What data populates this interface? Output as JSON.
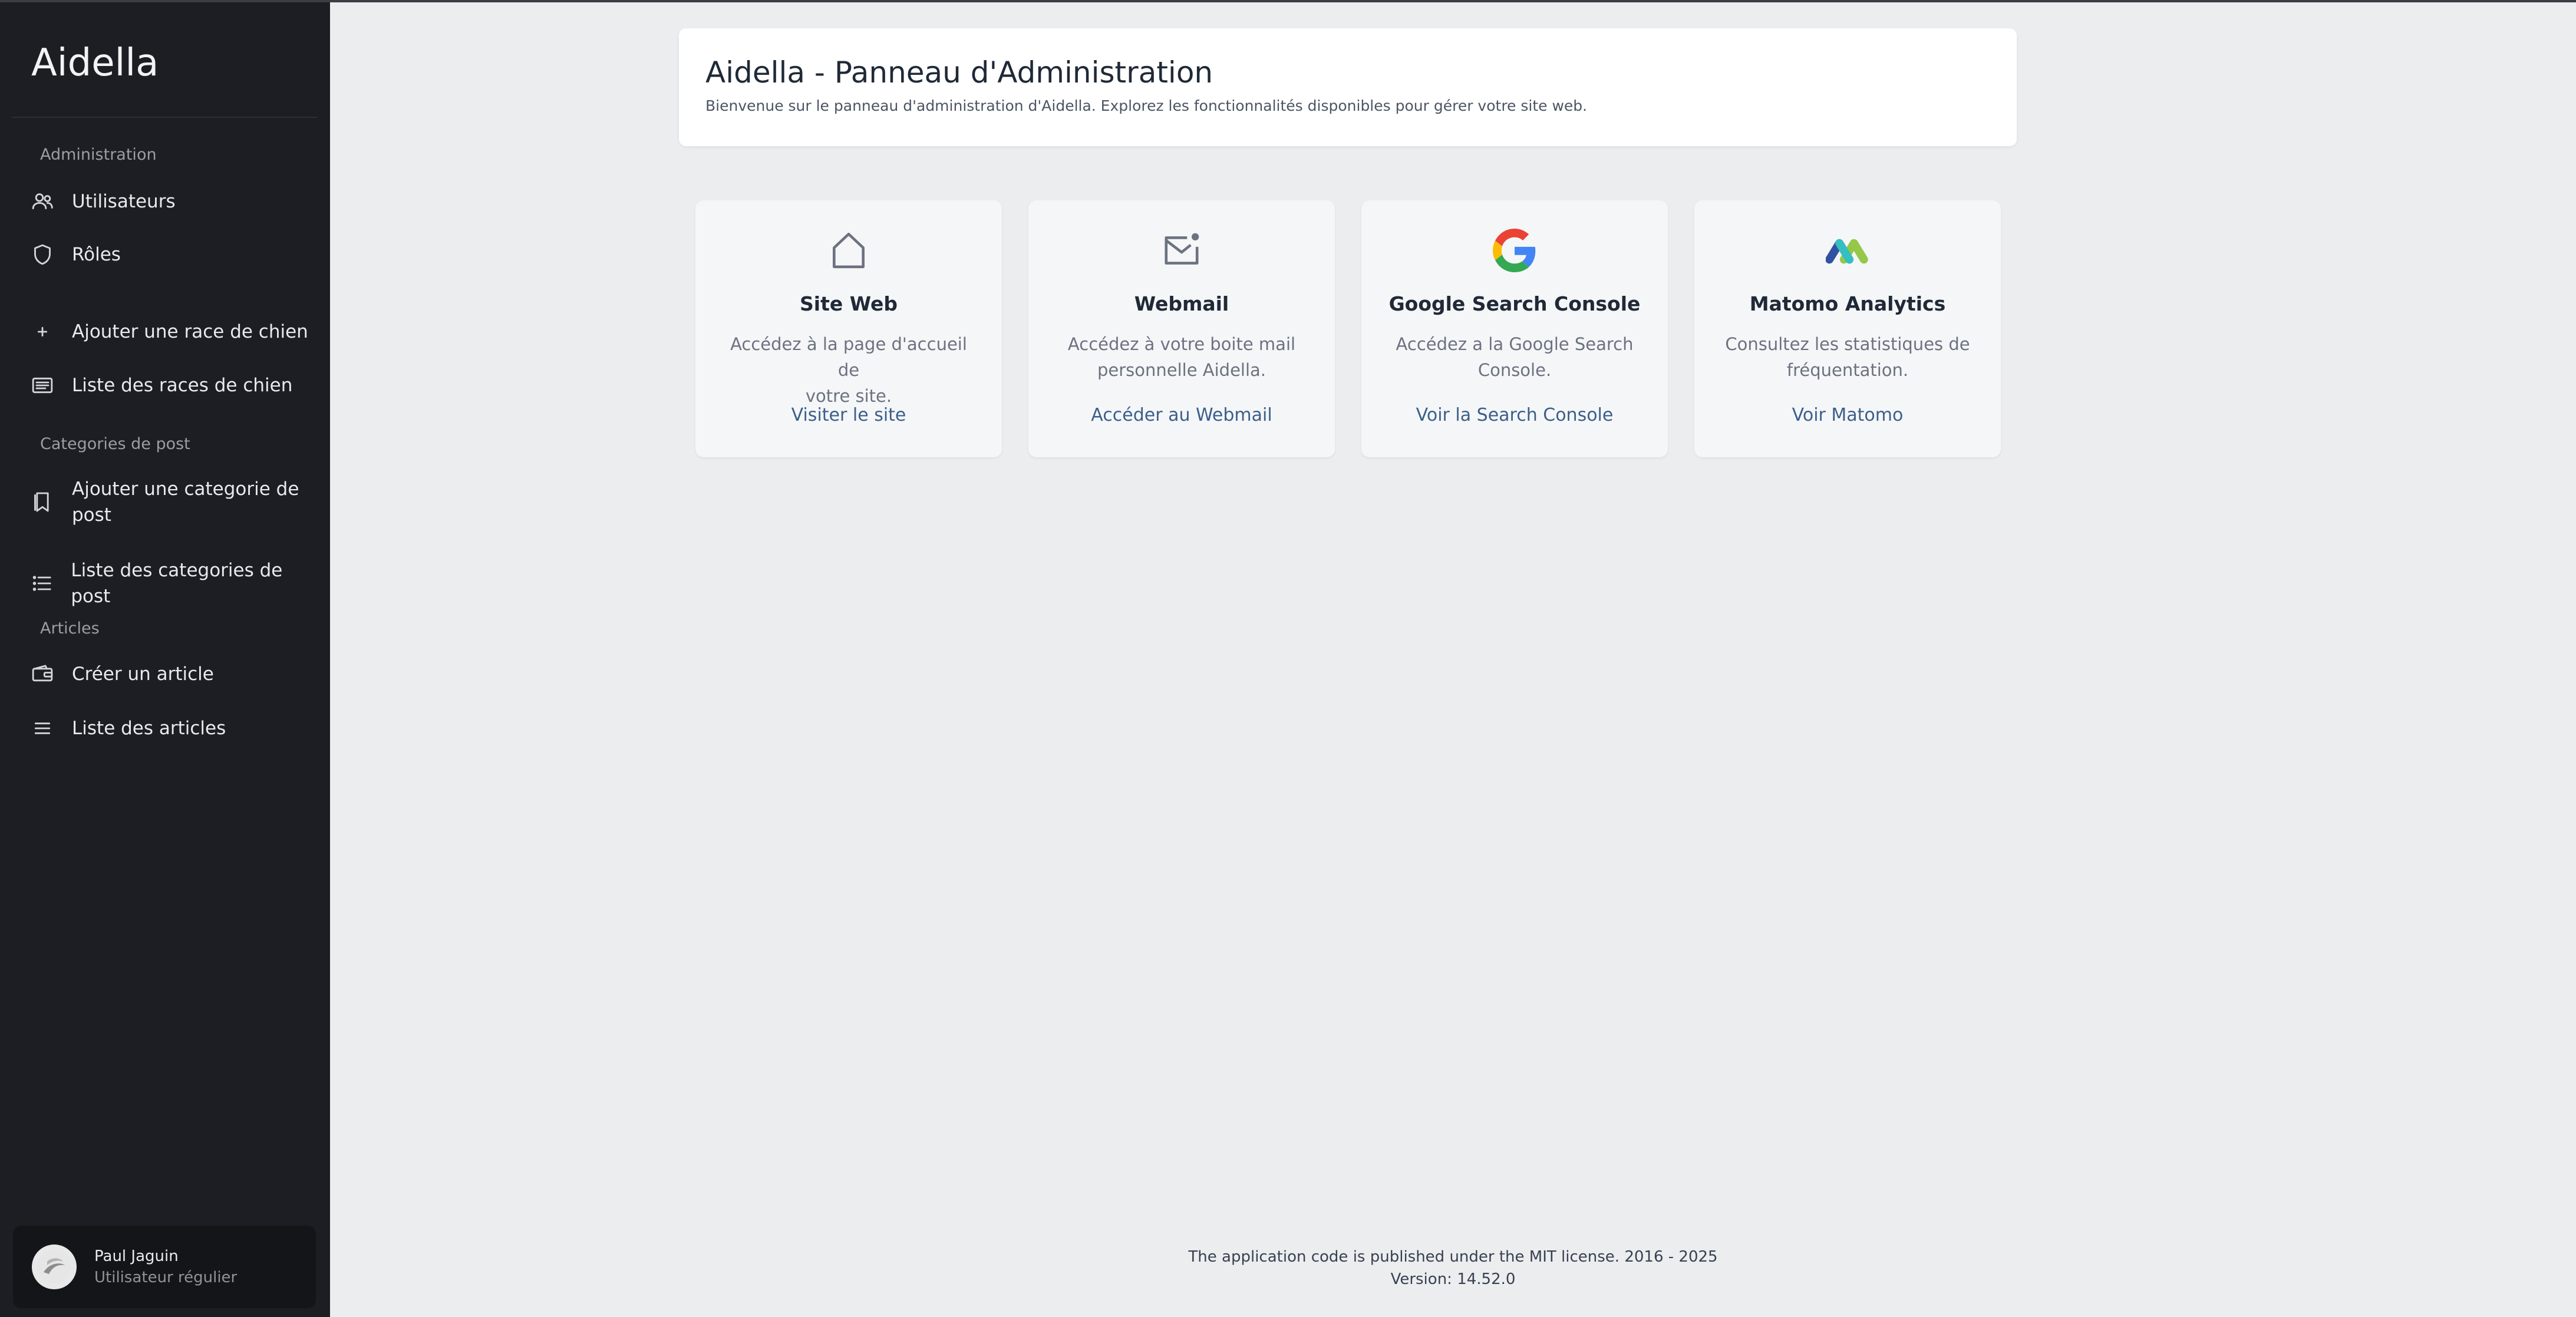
{
  "app": {
    "brand": "Aidella"
  },
  "sidebar": {
    "sections": [
      {
        "label": "Administration"
      },
      {
        "label": "Categories de post"
      },
      {
        "label": "Articles"
      }
    ],
    "items": [
      {
        "label": "Utilisateurs",
        "icon": "users-icon"
      },
      {
        "label": "Rôles",
        "icon": "shield-icon"
      },
      {
        "label": "Ajouter une race de chien",
        "icon": "plus-icon"
      },
      {
        "label": "Liste des races de chien",
        "icon": "list-card-icon"
      },
      {
        "label_line1": "Ajouter une categorie de",
        "label_line2": "post",
        "icon": "bookmark-icon"
      },
      {
        "label": "Liste des categories de post",
        "icon": "bullet-list-icon"
      },
      {
        "label": "Créer un article",
        "icon": "wallet-icon"
      },
      {
        "label": "Liste des articles",
        "icon": "menu-icon"
      }
    ],
    "user": {
      "name": "Paul Jaguin",
      "role": "Utilisateur régulier"
    }
  },
  "header": {
    "title": "Aidella - Panneau d'Administration",
    "subtitle": "Bienvenue sur le panneau d'administration d'Aidella. Explorez les fonctionnalités disponibles pour gérer votre site web."
  },
  "cards": [
    {
      "icon": "home-icon",
      "title": "Site Web",
      "desc_line1": "Accédez à la page d'accueil de",
      "desc_line2": "votre site.",
      "link": "Visiter le site"
    },
    {
      "icon": "mail-icon",
      "title": "Webmail",
      "desc_line1": "Accédez à votre boite mail",
      "desc_line2": "personnelle Aidella.",
      "link": "Accéder au Webmail"
    },
    {
      "icon": "google-icon",
      "title": "Google Search Console",
      "desc_line1": "Accédez a la Google Search",
      "desc_line2": "Console.",
      "link": "Voir la Search Console"
    },
    {
      "icon": "matomo-icon",
      "title": "Matomo Analytics",
      "desc_line1": "Consultez les statistiques de",
      "desc_line2": "fréquentation.",
      "link": "Voir Matomo"
    }
  ],
  "footer": {
    "license": "The application code is published under the MIT license. 2016 - 2025",
    "version": "Version: 14.52.0"
  },
  "colors": {
    "sidebar_bg": "#1d1e23",
    "main_bg": "#ecedef",
    "link": "#3b5f8a"
  }
}
